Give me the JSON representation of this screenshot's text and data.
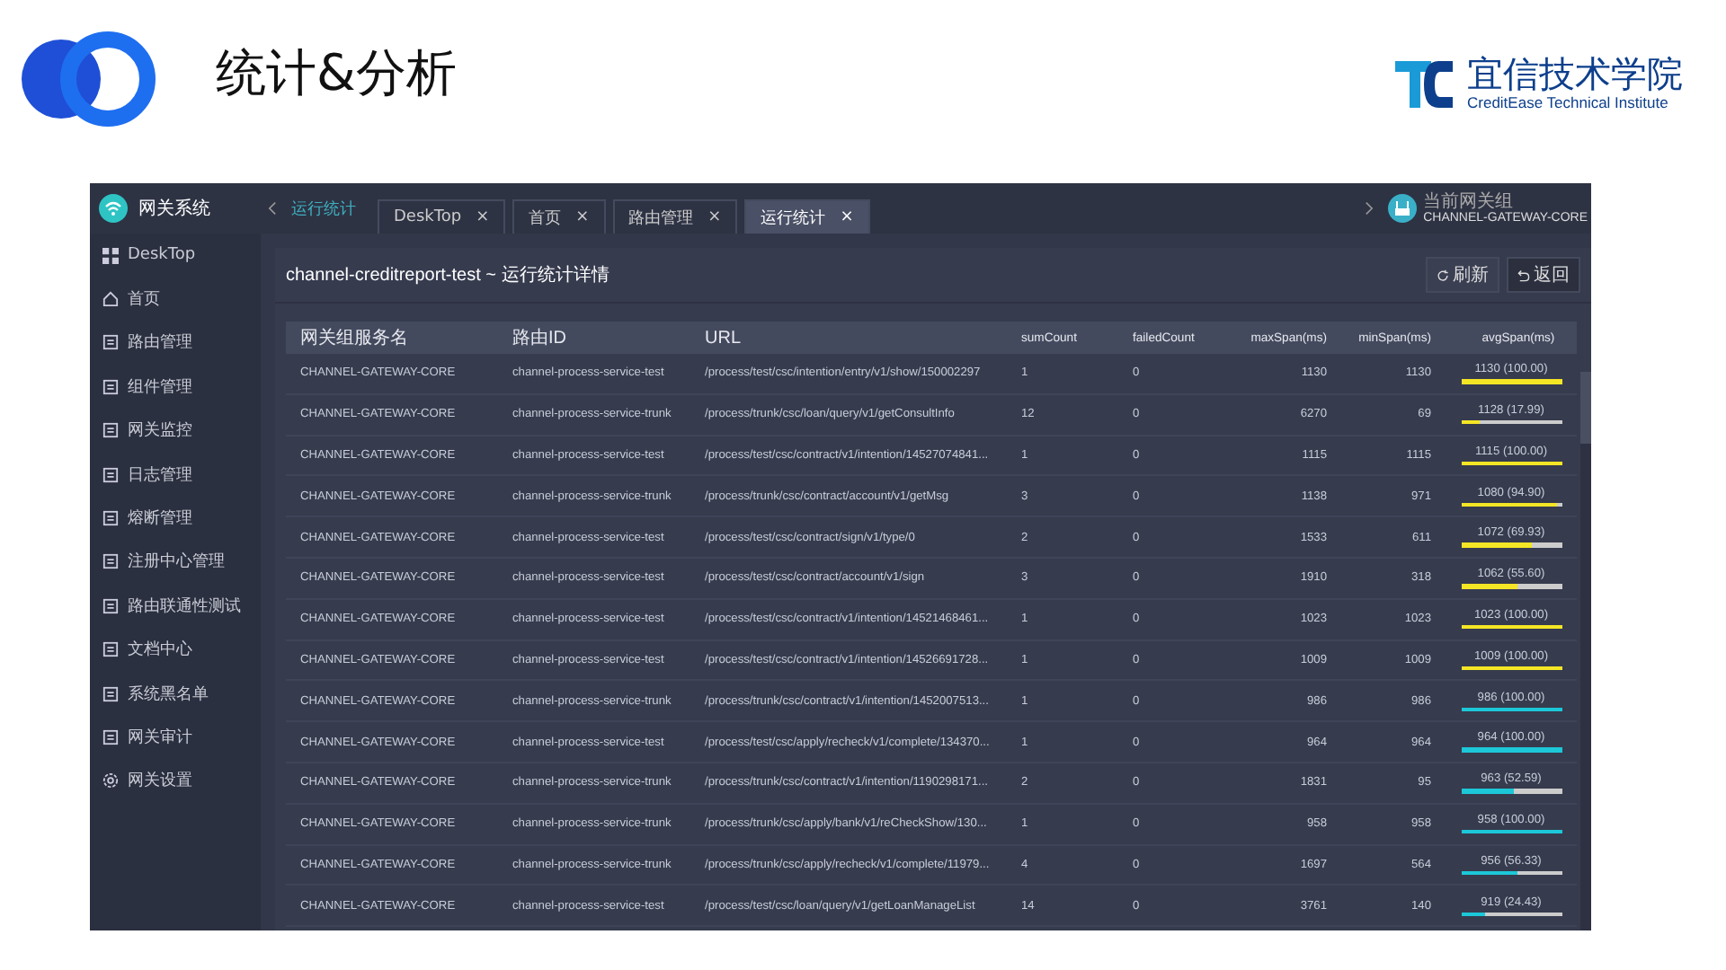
{
  "slide": {
    "title": "统计&分析",
    "brand": {
      "name": "宜信技术学院",
      "subtitle": "CreditEase Technical Institute"
    }
  },
  "sidebar": {
    "title": "网关系统",
    "items": [
      {
        "label": "DeskTop",
        "selected": false
      },
      {
        "label": "首页",
        "selected": false
      },
      {
        "label": "路由管理",
        "selected": false
      },
      {
        "label": "组件管理",
        "selected": false
      },
      {
        "label": "网关监控",
        "selected": false
      },
      {
        "label": "日志管理",
        "selected": false
      },
      {
        "label": "熔断管理",
        "selected": false
      },
      {
        "label": "注册中心管理",
        "selected": false
      },
      {
        "label": "路由联通性测试",
        "selected": false
      },
      {
        "label": "文档中心",
        "selected": false
      },
      {
        "label": "系统黑名单",
        "selected": false
      },
      {
        "label": "网关审计",
        "selected": false
      },
      {
        "label": "网关设置",
        "selected": false
      }
    ]
  },
  "topbar": {
    "breadcrumb": "运行统计",
    "tabs": [
      {
        "label": "DeskTop",
        "close": "×",
        "selected": false
      },
      {
        "label": "首页",
        "close": "×",
        "selected": false
      },
      {
        "label": "路由管理",
        "close": "×",
        "selected": false
      },
      {
        "label": "运行统计",
        "close": "×",
        "selected": true
      }
    ],
    "gateway_label": "当前网关组",
    "gateway": "CHANNEL-GATEWAY-CORE"
  },
  "panel": {
    "title": "channel-creditreport-test ~ 运行统计详情",
    "buttons": [
      "刷新",
      "返回"
    ]
  },
  "table": {
    "columns": [
      "网关组服务名",
      "路由ID",
      "URL",
      "sumCount",
      "failedCount",
      "maxSpan(ms)",
      "minSpan(ms)",
      "avgSpan(ms)"
    ],
    "rows": [
      {
        "cells": [
          "CHANNEL-GATEWAY-CORE",
          "channel-process-service-test",
          "/process/test/csc/intention/entry/v1/show/150002297",
          "1",
          "0",
          "1130",
          "1130"
        ],
        "avg": "1130 (100.00)",
        "level": 1.0,
        "color": "#f5e625"
      },
      {
        "cells": [
          "CHANNEL-GATEWAY-CORE",
          "channel-process-service-trunk",
          "/process/trunk/csc/loan/query/v1/getConsultInfo",
          "12",
          "0",
          "6270",
          "69"
        ],
        "avg": "1128 (17.99)",
        "level": 0.18,
        "color": "#f5e625"
      },
      {
        "cells": [
          "CHANNEL-GATEWAY-CORE",
          "channel-process-service-test",
          "/process/test/csc/contract/v1/intention/14527074841...",
          "1",
          "0",
          "1115",
          "1115"
        ],
        "avg": "1115 (100.00)",
        "level": 1.0,
        "color": "#f5e625"
      },
      {
        "cells": [
          "CHANNEL-GATEWAY-CORE",
          "channel-process-service-trunk",
          "/process/trunk/csc/contract/account/v1/getMsg",
          "3",
          "0",
          "1138",
          "971"
        ],
        "avg": "1080 (94.90)",
        "level": 0.949,
        "color": "#f5e625"
      },
      {
        "cells": [
          "CHANNEL-GATEWAY-CORE",
          "channel-process-service-test",
          "/process/test/csc/contract/sign/v1/type/0",
          "2",
          "0",
          "1533",
          "611"
        ],
        "avg": "1072 (69.93)",
        "level": 0.699,
        "color": "#f5e625"
      },
      {
        "cells": [
          "CHANNEL-GATEWAY-CORE",
          "channel-process-service-test",
          "/process/test/csc/contract/account/v1/sign",
          "3",
          "0",
          "1910",
          "318"
        ],
        "avg": "1062 (55.60)",
        "level": 0.556,
        "color": "#f5e625"
      },
      {
        "cells": [
          "CHANNEL-GATEWAY-CORE",
          "channel-process-service-test",
          "/process/test/csc/contract/v1/intention/14521468461...",
          "1",
          "0",
          "1023",
          "1023"
        ],
        "avg": "1023 (100.00)",
        "level": 1.0,
        "color": "#f5e625"
      },
      {
        "cells": [
          "CHANNEL-GATEWAY-CORE",
          "channel-process-service-test",
          "/process/test/csc/contract/v1/intention/14526691728...",
          "1",
          "0",
          "1009",
          "1009"
        ],
        "avg": "1009 (100.00)",
        "level": 1.0,
        "color": "#f5e625"
      },
      {
        "cells": [
          "CHANNEL-GATEWAY-CORE",
          "channel-process-service-trunk",
          "/process/trunk/csc/contract/v1/intention/1452007513...",
          "1",
          "0",
          "986",
          "986"
        ],
        "avg": "986 (100.00)",
        "level": 1.0,
        "color": "#1cc8d8"
      },
      {
        "cells": [
          "CHANNEL-GATEWAY-CORE",
          "channel-process-service-test",
          "/process/test/csc/apply/recheck/v1/complete/134370...",
          "1",
          "0",
          "964",
          "964"
        ],
        "avg": "964 (100.00)",
        "level": 1.0,
        "color": "#1cc8d8"
      },
      {
        "cells": [
          "CHANNEL-GATEWAY-CORE",
          "channel-process-service-trunk",
          "/process/trunk/csc/contract/v1/intention/1190298171...",
          "2",
          "0",
          "1831",
          "95"
        ],
        "avg": "963 (52.59)",
        "level": 0.526,
        "color": "#1cc8d8"
      },
      {
        "cells": [
          "CHANNEL-GATEWAY-CORE",
          "channel-process-service-trunk",
          "/process/trunk/csc/apply/bank/v1/reCheckShow/130...",
          "1",
          "0",
          "958",
          "958"
        ],
        "avg": "958 (100.00)",
        "level": 1.0,
        "color": "#1cc8d8"
      },
      {
        "cells": [
          "CHANNEL-GATEWAY-CORE",
          "channel-process-service-trunk",
          "/process/trunk/csc/apply/recheck/v1/complete/11979...",
          "4",
          "0",
          "1697",
          "564"
        ],
        "avg": "956 (56.33)",
        "level": 0.563,
        "color": "#1cc8d8"
      },
      {
        "cells": [
          "CHANNEL-GATEWAY-CORE",
          "channel-process-service-test",
          "/process/test/csc/loan/query/v1/getLoanManageList",
          "14",
          "0",
          "3761",
          "140"
        ],
        "avg": "919 (24.43)",
        "level": 0.244,
        "color": "#1cc8d8"
      }
    ]
  }
}
